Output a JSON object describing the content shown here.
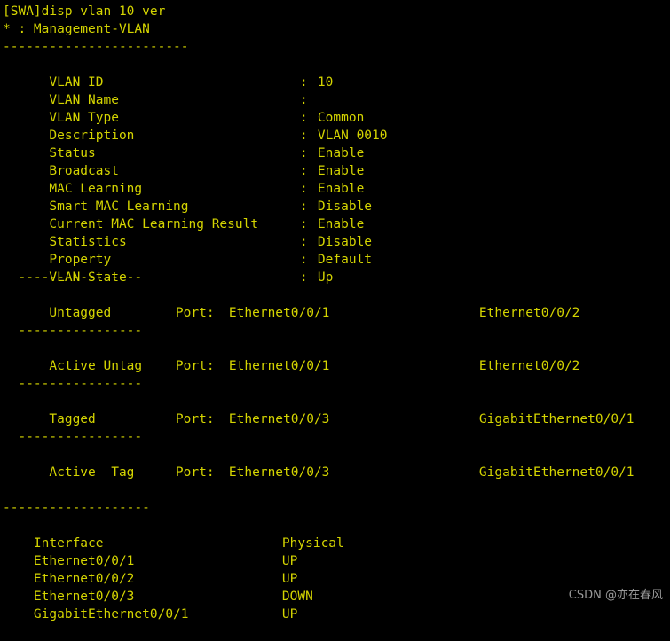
{
  "terminal": {
    "colors": {
      "background": "#000000",
      "text": "#d4d400",
      "watermark": "#9a9a9a"
    },
    "prompt_line": "[SWA]disp vlan 10 ver",
    "legend_line": "* : Management-VLAN",
    "separator_top": "------------------------",
    "separator_block": "  ----------------",
    "separator_bottom": "-------------------",
    "blank": " "
  },
  "vlan_properties": [
    {
      "key": "  VLAN ID",
      "sep": ":",
      "value": "10"
    },
    {
      "key": "  VLAN Name",
      "sep": ":",
      "value": ""
    },
    {
      "key": "  VLAN Type",
      "sep": ":",
      "value": "Common"
    },
    {
      "key": "  Description",
      "sep": ":",
      "value": "VLAN 0010"
    },
    {
      "key": "  Status",
      "sep": ":",
      "value": "Enable"
    },
    {
      "key": "  Broadcast",
      "sep": ":",
      "value": "Enable"
    },
    {
      "key": "  MAC Learning",
      "sep": ":",
      "value": "Enable"
    },
    {
      "key": "  Smart MAC Learning",
      "sep": ":",
      "value": "Disable"
    },
    {
      "key": "  Current MAC Learning Result",
      "sep": ":",
      "value": "Enable"
    },
    {
      "key": "  Statistics",
      "sep": ":",
      "value": "Disable"
    },
    {
      "key": "  Property",
      "sep": ":",
      "value": "Default"
    },
    {
      "key": "  VLAN State",
      "sep": ":",
      "value": "Up"
    }
  ],
  "port_blocks": [
    {
      "name": "untagged-ports",
      "label": "  Untagged",
      "port_tag": "Port:",
      "ports": [
        "Ethernet0/0/1",
        "Ethernet0/0/2"
      ]
    },
    {
      "name": "active-untagged-ports",
      "label": "  Active Untag",
      "port_tag": "Port:",
      "ports": [
        "Ethernet0/0/1",
        "Ethernet0/0/2"
      ]
    },
    {
      "name": "tagged-ports",
      "label": "  Tagged",
      "port_tag": "Port:",
      "ports": [
        "Ethernet0/0/3",
        "GigabitEthernet0/0/1"
      ]
    },
    {
      "name": "active-tagged-ports",
      "label": "  Active  Tag",
      "port_tag": "Port:",
      "ports": [
        "Ethernet0/0/3",
        "GigabitEthernet0/0/1"
      ]
    }
  ],
  "interface_table": {
    "headers": [
      "Interface",
      "Physical"
    ],
    "rows": [
      {
        "interface": "Ethernet0/0/1",
        "physical": "UP"
      },
      {
        "interface": "Ethernet0/0/2",
        "physical": "UP"
      },
      {
        "interface": "Ethernet0/0/3",
        "physical": "DOWN"
      },
      {
        "interface": "GigabitEthernet0/0/1",
        "physical": "UP"
      }
    ]
  },
  "watermark": {
    "text": "CSDN @亦在春风"
  }
}
